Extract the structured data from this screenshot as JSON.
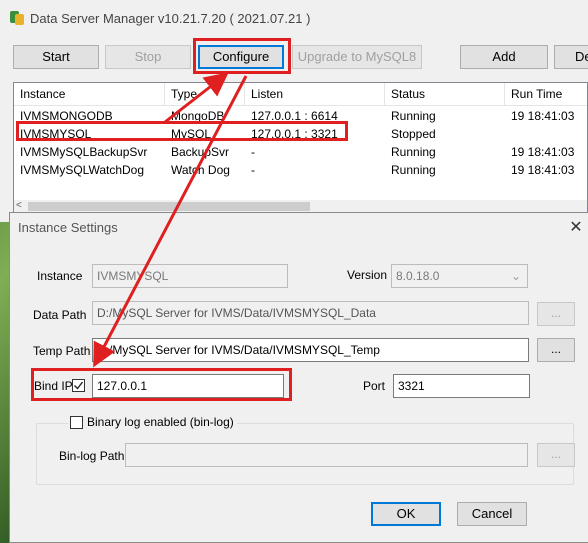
{
  "window": {
    "title": "Data Server Manager v10.21.7.20 ( 2021.07.21 )"
  },
  "toolbar": {
    "start": "Start",
    "stop": "Stop",
    "configure": "Configure",
    "upgrade": "Upgrade to MySQL8",
    "add": "Add",
    "delete_partial": "De"
  },
  "instances": {
    "columns": [
      "Instance",
      "Type",
      "Listen",
      "Status",
      "Run Time"
    ],
    "rows": [
      [
        "IVMSMONGODB",
        "MongoDB",
        "127.0.0.1 : 6614",
        "Running",
        "19 18:41:03"
      ],
      [
        "IVMSMYSQL",
        "MySQL",
        "127.0.0.1 : 3321",
        "Stopped",
        ""
      ],
      [
        "IVMSMySQLBackupSvr",
        "BackupSvr",
        "-",
        "Running",
        "19 18:41:03"
      ],
      [
        "IVMSMySQLWatchDog",
        "Watch Dog",
        "-",
        "Running",
        "19 18:41:03"
      ]
    ],
    "scroll_left_glyph": "<"
  },
  "dialog": {
    "title": "Instance Settings",
    "close_glyph": "✕",
    "instance_label": "Instance",
    "instance_value": "IVMSMYSQL",
    "version_label": "Version",
    "version_value": "8.0.18.0",
    "data_path_label": "Data Path",
    "data_path_value": "D:/MySQL Server for IVMS/Data/IVMSMYSQL_Data",
    "temp_path_label": "Temp Path",
    "temp_path_value": "D:/MySQL Server for IVMS/Data/IVMSMYSQL_Temp",
    "browse_label": "...",
    "bind_ip_label": "Bind IP",
    "bind_ip_checked": true,
    "bind_ip_value": "127.0.0.1",
    "port_label": "Port",
    "port_value": "3321",
    "binlog_label": "Binary log enabled (bin-log)",
    "binlog_checked": false,
    "binlog_path_label": "Bin-log Path",
    "binlog_path_value": "",
    "ok": "OK",
    "cancel": "Cancel"
  },
  "colors": {
    "annotation": "#e02020",
    "accent": "#0078d7"
  }
}
